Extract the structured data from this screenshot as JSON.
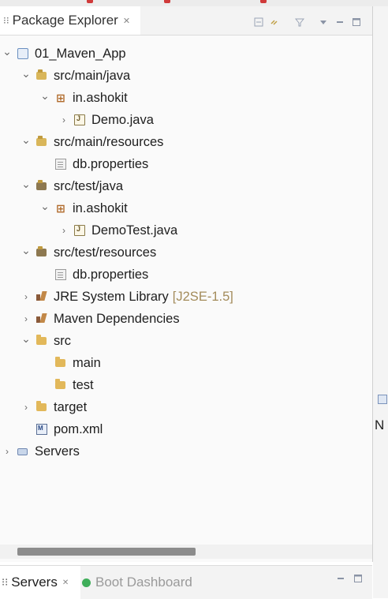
{
  "package_explorer": {
    "tab_label": "Package Explorer",
    "tree": [
      {
        "label": "01_Maven_App",
        "icon": "project-icon",
        "depth": 0,
        "expanded": true
      },
      {
        "label": "src/main/java",
        "icon": "source-folder-icon",
        "depth": 1,
        "expanded": true
      },
      {
        "label": "in.ashokit",
        "icon": "package-icon",
        "depth": 2,
        "expanded": true
      },
      {
        "label": "Demo.java",
        "icon": "java-file-icon",
        "depth": 3,
        "expanded": false
      },
      {
        "label": "src/main/resources",
        "icon": "source-folder-icon",
        "depth": 1,
        "expanded": true
      },
      {
        "label": "db.properties",
        "icon": "properties-file-icon",
        "depth": 2,
        "expanded": null
      },
      {
        "label": "src/test/java",
        "icon": "test-source-folder-icon",
        "depth": 1,
        "expanded": true
      },
      {
        "label": "in.ashokit",
        "icon": "package-icon",
        "depth": 2,
        "expanded": true
      },
      {
        "label": "DemoTest.java",
        "icon": "java-file-icon",
        "depth": 3,
        "expanded": false
      },
      {
        "label": "src/test/resources",
        "icon": "test-source-folder-icon",
        "depth": 1,
        "expanded": true
      },
      {
        "label": "db.properties",
        "icon": "properties-file-icon",
        "depth": 2,
        "expanded": null
      },
      {
        "label": "JRE System Library",
        "decoration": "[J2SE-1.5]",
        "icon": "library-icon",
        "depth": 1,
        "expanded": false
      },
      {
        "label": "Maven Dependencies",
        "icon": "library-icon",
        "depth": 1,
        "expanded": false
      },
      {
        "label": "src",
        "icon": "folder-icon",
        "depth": 1,
        "expanded": true
      },
      {
        "label": "main",
        "icon": "folder-icon",
        "depth": 2,
        "expanded": null
      },
      {
        "label": "test",
        "icon": "folder-icon",
        "depth": 2,
        "expanded": null
      },
      {
        "label": "target",
        "icon": "folder-icon",
        "depth": 1,
        "expanded": false
      },
      {
        "label": "pom.xml",
        "icon": "xml-file-icon",
        "depth": 1,
        "expanded": null
      },
      {
        "label": "Servers",
        "icon": "servers-folder-icon",
        "depth": 0,
        "expanded": false
      }
    ]
  },
  "bottom_panel": {
    "tabs": [
      {
        "label": "Servers",
        "icon": "servers-icon",
        "active": true
      },
      {
        "label": "Boot Dashboard",
        "icon": "boot-icon",
        "active": false
      }
    ]
  },
  "right_edge": {
    "label": "N"
  }
}
